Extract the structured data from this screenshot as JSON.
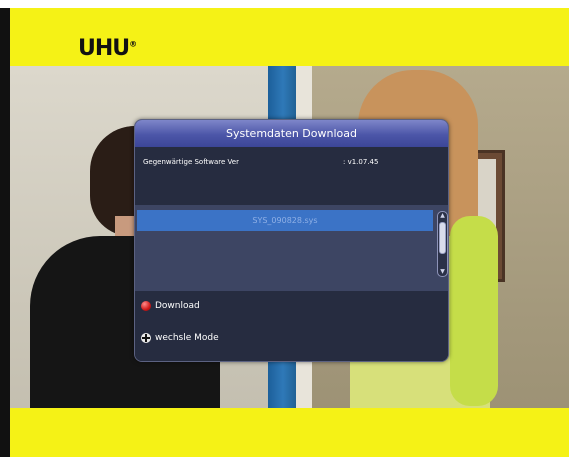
{
  "brand": {
    "logo": "UHU",
    "mark": "®"
  },
  "dialog": {
    "title": "Systemdaten Download",
    "info_label": "Gegenwärtige Software Ver",
    "info_value": ": v1.07.45",
    "files": [
      "SYS_090828.sys"
    ],
    "selected_index": 0
  },
  "footer": {
    "download_label": "Download",
    "mode_label": "wechsle Mode"
  },
  "colors": {
    "accent": "#3b73c6",
    "frame_yellow": "#f5f216",
    "title_bar": "#4c56a8"
  }
}
